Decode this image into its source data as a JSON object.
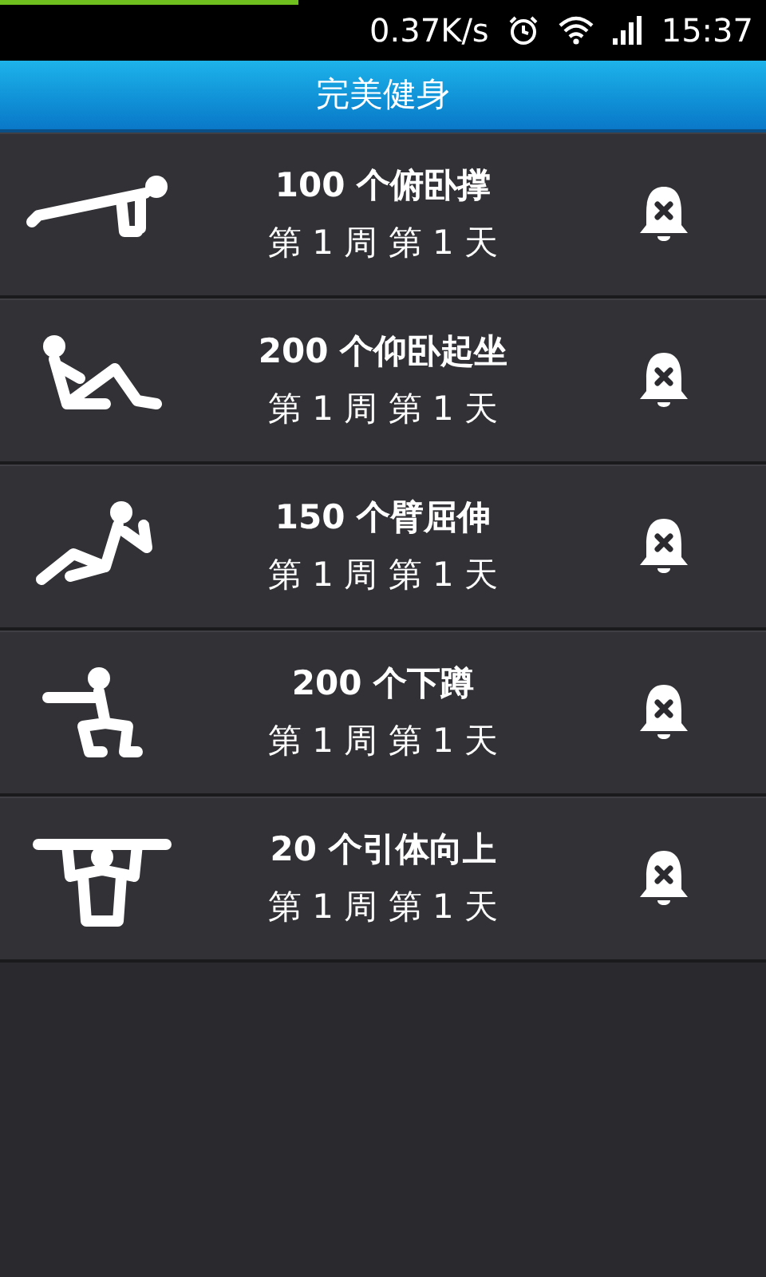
{
  "status_bar": {
    "progress": {
      "level": 0.39
    },
    "speed": "0.37K/s",
    "time": "15:37"
  },
  "title": "完美健身",
  "exercises": [
    {
      "kind": "pushup",
      "name": "100 个俯卧撑",
      "progress": "第 1 周 第 1 天",
      "alarm_on": false
    },
    {
      "kind": "situp",
      "name": "200 个仰卧起坐",
      "progress": "第 1 周 第 1 天",
      "alarm_on": false
    },
    {
      "kind": "dip",
      "name": "150 个臂屈伸",
      "progress": "第 1 周 第 1 天",
      "alarm_on": false
    },
    {
      "kind": "squat",
      "name": "200 个下蹲",
      "progress": "第 1 周 第 1 天",
      "alarm_on": false
    },
    {
      "kind": "pullup",
      "name": "20 个引体向上",
      "progress": "第 1 周 第 1 天",
      "alarm_on": false
    }
  ]
}
